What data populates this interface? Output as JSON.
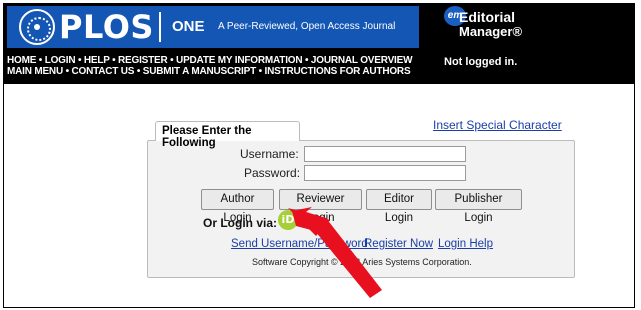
{
  "header": {
    "logo_text": "PLOS",
    "journal_name": "ONE",
    "journal_tagline": "A Peer-Reviewed, Open Access Journal",
    "em_badge": "em",
    "em_line1": "Editorial",
    "em_line2": "Manager®",
    "status": "Not logged in.",
    "nav_row1": [
      "HOME",
      "LOGIN",
      "HELP",
      "REGISTER",
      "UPDATE MY INFORMATION",
      "JOURNAL OVERVIEW"
    ],
    "nav_row2": [
      "MAIN MENU",
      "CONTACT US",
      "SUBMIT A MANUSCRIPT",
      "INSTRUCTIONS FOR AUTHORS"
    ],
    "nav_separator": "•"
  },
  "login": {
    "special_character_link": "Insert Special Character",
    "tab_title": "Please Enter the Following",
    "username_label": "Username:",
    "username_value": "",
    "password_label": "Password:",
    "password_value": "",
    "buttons": [
      "Author Login",
      "Reviewer Login",
      "Editor Login",
      "Publisher Login"
    ],
    "or_login_via": "Or Login via:",
    "orcid_icon_text": "iD",
    "links": [
      "Send Username/Password",
      "Register Now",
      "Login Help"
    ],
    "copyright": "Software Copyright © 2018 Aries Systems Corporation."
  },
  "colors": {
    "plos_blue": "#1456b3",
    "link_blue": "#1a3ea6",
    "orcid_green": "#a6ce39",
    "arrow_red": "#e8101f"
  }
}
